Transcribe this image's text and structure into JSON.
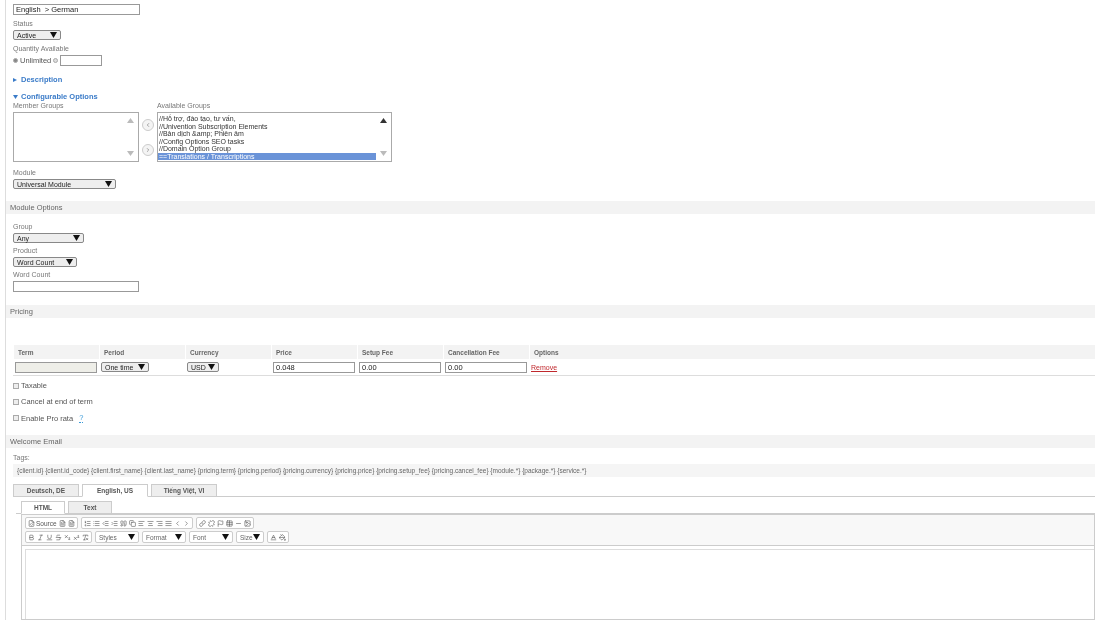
{
  "name_field": {
    "value": "English  > German"
  },
  "status": {
    "label": "Status",
    "value": "Active"
  },
  "quantity": {
    "label": "Quantity Available",
    "options": [
      {
        "label": "Unlimited",
        "selected": true
      },
      {
        "selected": false
      }
    ]
  },
  "sections_collapsible": [
    {
      "label": "Description",
      "expanded": false
    },
    {
      "label": "Configurable Options",
      "expanded": true
    }
  ],
  "member_groups": {
    "label": "Member Groups"
  },
  "available_groups": {
    "label": "Available Groups",
    "items": [
      {
        "label": "//Hỗ trợ, đào tạo, tư vấn,",
        "selected": false
      },
      {
        "label": "//Univention Subscription Elements",
        "selected": false
      },
      {
        "label": "//Bản dịch &amp; Phiên âm",
        "selected": false
      },
      {
        "label": "//Config Options SEO tasks",
        "selected": false
      },
      {
        "label": "//Domain Option Group",
        "selected": false
      },
      {
        "label": "==Translations / Transcriptions",
        "selected": true
      }
    ]
  },
  "module": {
    "label": "Module",
    "value": "Universal Module"
  },
  "module_options": {
    "title": "Module Options",
    "fields": [
      {
        "kind": "select",
        "label": "Group",
        "value": "Any"
      },
      {
        "kind": "select",
        "label": "Product",
        "value": "Word Count"
      },
      {
        "kind": "text",
        "label": "Word Count"
      }
    ]
  },
  "pricing": {
    "title": "Pricing",
    "columns": [
      "Term",
      "Period",
      "Currency",
      "Price",
      "Setup Fee",
      "Cancellation Fee",
      "Options"
    ],
    "row": {
      "period": "One time",
      "currency": "USD",
      "price": "0.048",
      "setup_fee": "0.00",
      "cancellation_fee": "0.00",
      "action": "Remove"
    },
    "checkboxes": [
      {
        "label": "Taxable",
        "checked": false
      },
      {
        "label": "Cancel at end of term",
        "checked": false
      },
      {
        "label": "Enable Pro rata",
        "checked": false,
        "help": "?"
      }
    ]
  },
  "welcome_email": {
    "title": "Welcome Email",
    "tags_label": "Tags:",
    "tags": "{client.id} {client.id_code} {client.first_name} {client.last_name} {pricing.term} {pricing.period} {pricing.currency} {pricing.price} {pricing.setup_fee} {pricing.cancel_fee} {module.*} {package.*} {service.*}",
    "language_tabs": [
      {
        "label": "Deutsch, DE",
        "selected": false
      },
      {
        "label": "English, US",
        "selected": true
      },
      {
        "label": "Tiếng Việt, VI",
        "selected": false
      }
    ],
    "format_tabs": [
      {
        "label": "HTML",
        "selected": true
      },
      {
        "label": "Text",
        "selected": false
      }
    ],
    "editor": {
      "source_label": "Source",
      "dropdowns": [
        "Styles",
        "Format",
        "Font",
        "Size"
      ]
    }
  }
}
